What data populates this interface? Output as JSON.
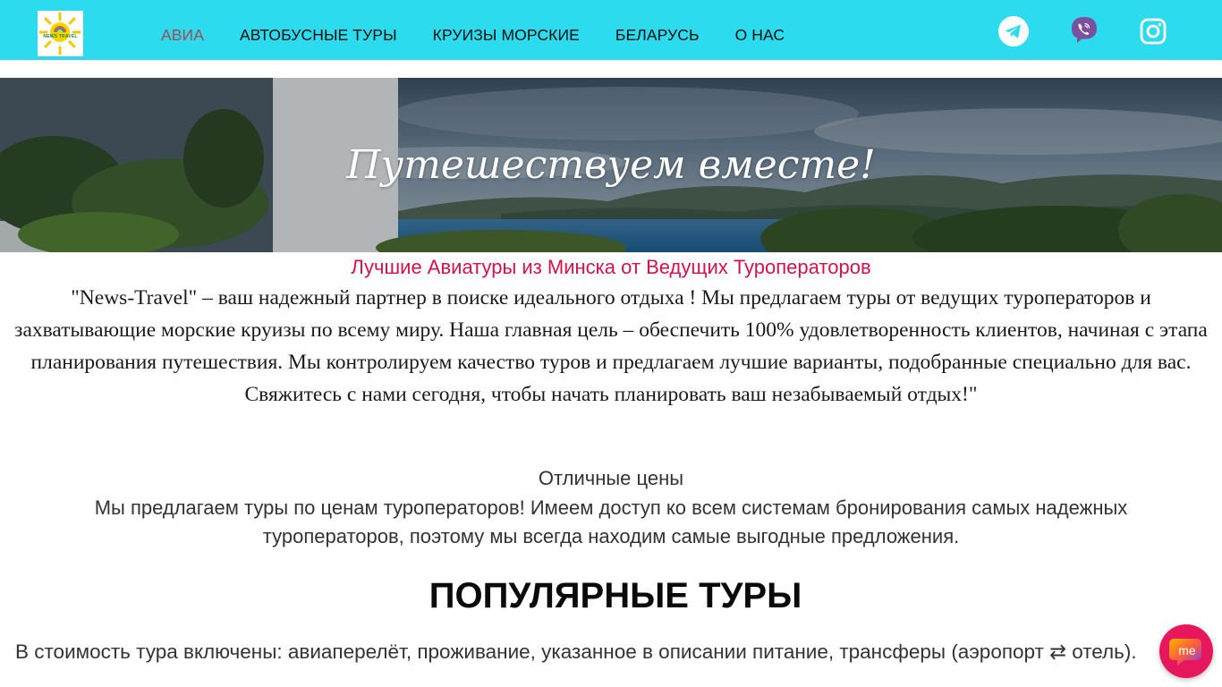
{
  "header": {
    "logo_text": "NEWS TRAVEL",
    "nav": [
      {
        "label": "АВИА",
        "active": true
      },
      {
        "label": "АВТОБУСНЫЕ ТУРЫ",
        "active": false
      },
      {
        "label": "КРУИЗЫ МОРСКИЕ",
        "active": false
      },
      {
        "label": "БЕЛАРУСЬ",
        "active": false
      },
      {
        "label": "О НАС",
        "active": false
      }
    ],
    "social": [
      "telegram-icon",
      "viber-icon",
      "instagram-icon"
    ]
  },
  "hero": {
    "title": "Путешествуем вместе!"
  },
  "main": {
    "subtitle": "Лучшие Авиатуры из Минска от Ведущих Туроператоров",
    "intro": "\"News-Travel\" – ваш надежный партнер в поиске идеального отдыха ! Мы предлагаем туры от ведущих туроператоров и захватывающие морские круизы по всему миру. Наша главная цель – обеспечить 100% удовлетворенность клиентов, начиная с этапа планирования путешествия. Мы контролируем качество туров и предлагаем лучшие варианты, подобранные специально для вас. Свяжитесь с нами сегодня, чтобы начать планировать ваш незабываемый отдых!\"",
    "feature_title": "Отличные цены",
    "feature_text": "Мы предлагаем туры по ценам туроператоров! Имеем доступ ко всем системам бронирования самых надежных туроператоров, поэтому мы всегда находим самые выгодные предложения.",
    "section_title": "ПОПУЛЯРНЫЕ ТУРЫ",
    "included": "В стоимость тура включены: авиаперелёт, проживание, указанное в описании питание, трансферы (аэропорт ⇄ отель)."
  },
  "chat": {
    "label": "me",
    "icon": "chat-widget-icon"
  },
  "colors": {
    "header_bg": "#2cdbee",
    "nav_active": "#a44b5a",
    "accent_red": "#d6114c",
    "chat_bg": "#e8175d"
  }
}
